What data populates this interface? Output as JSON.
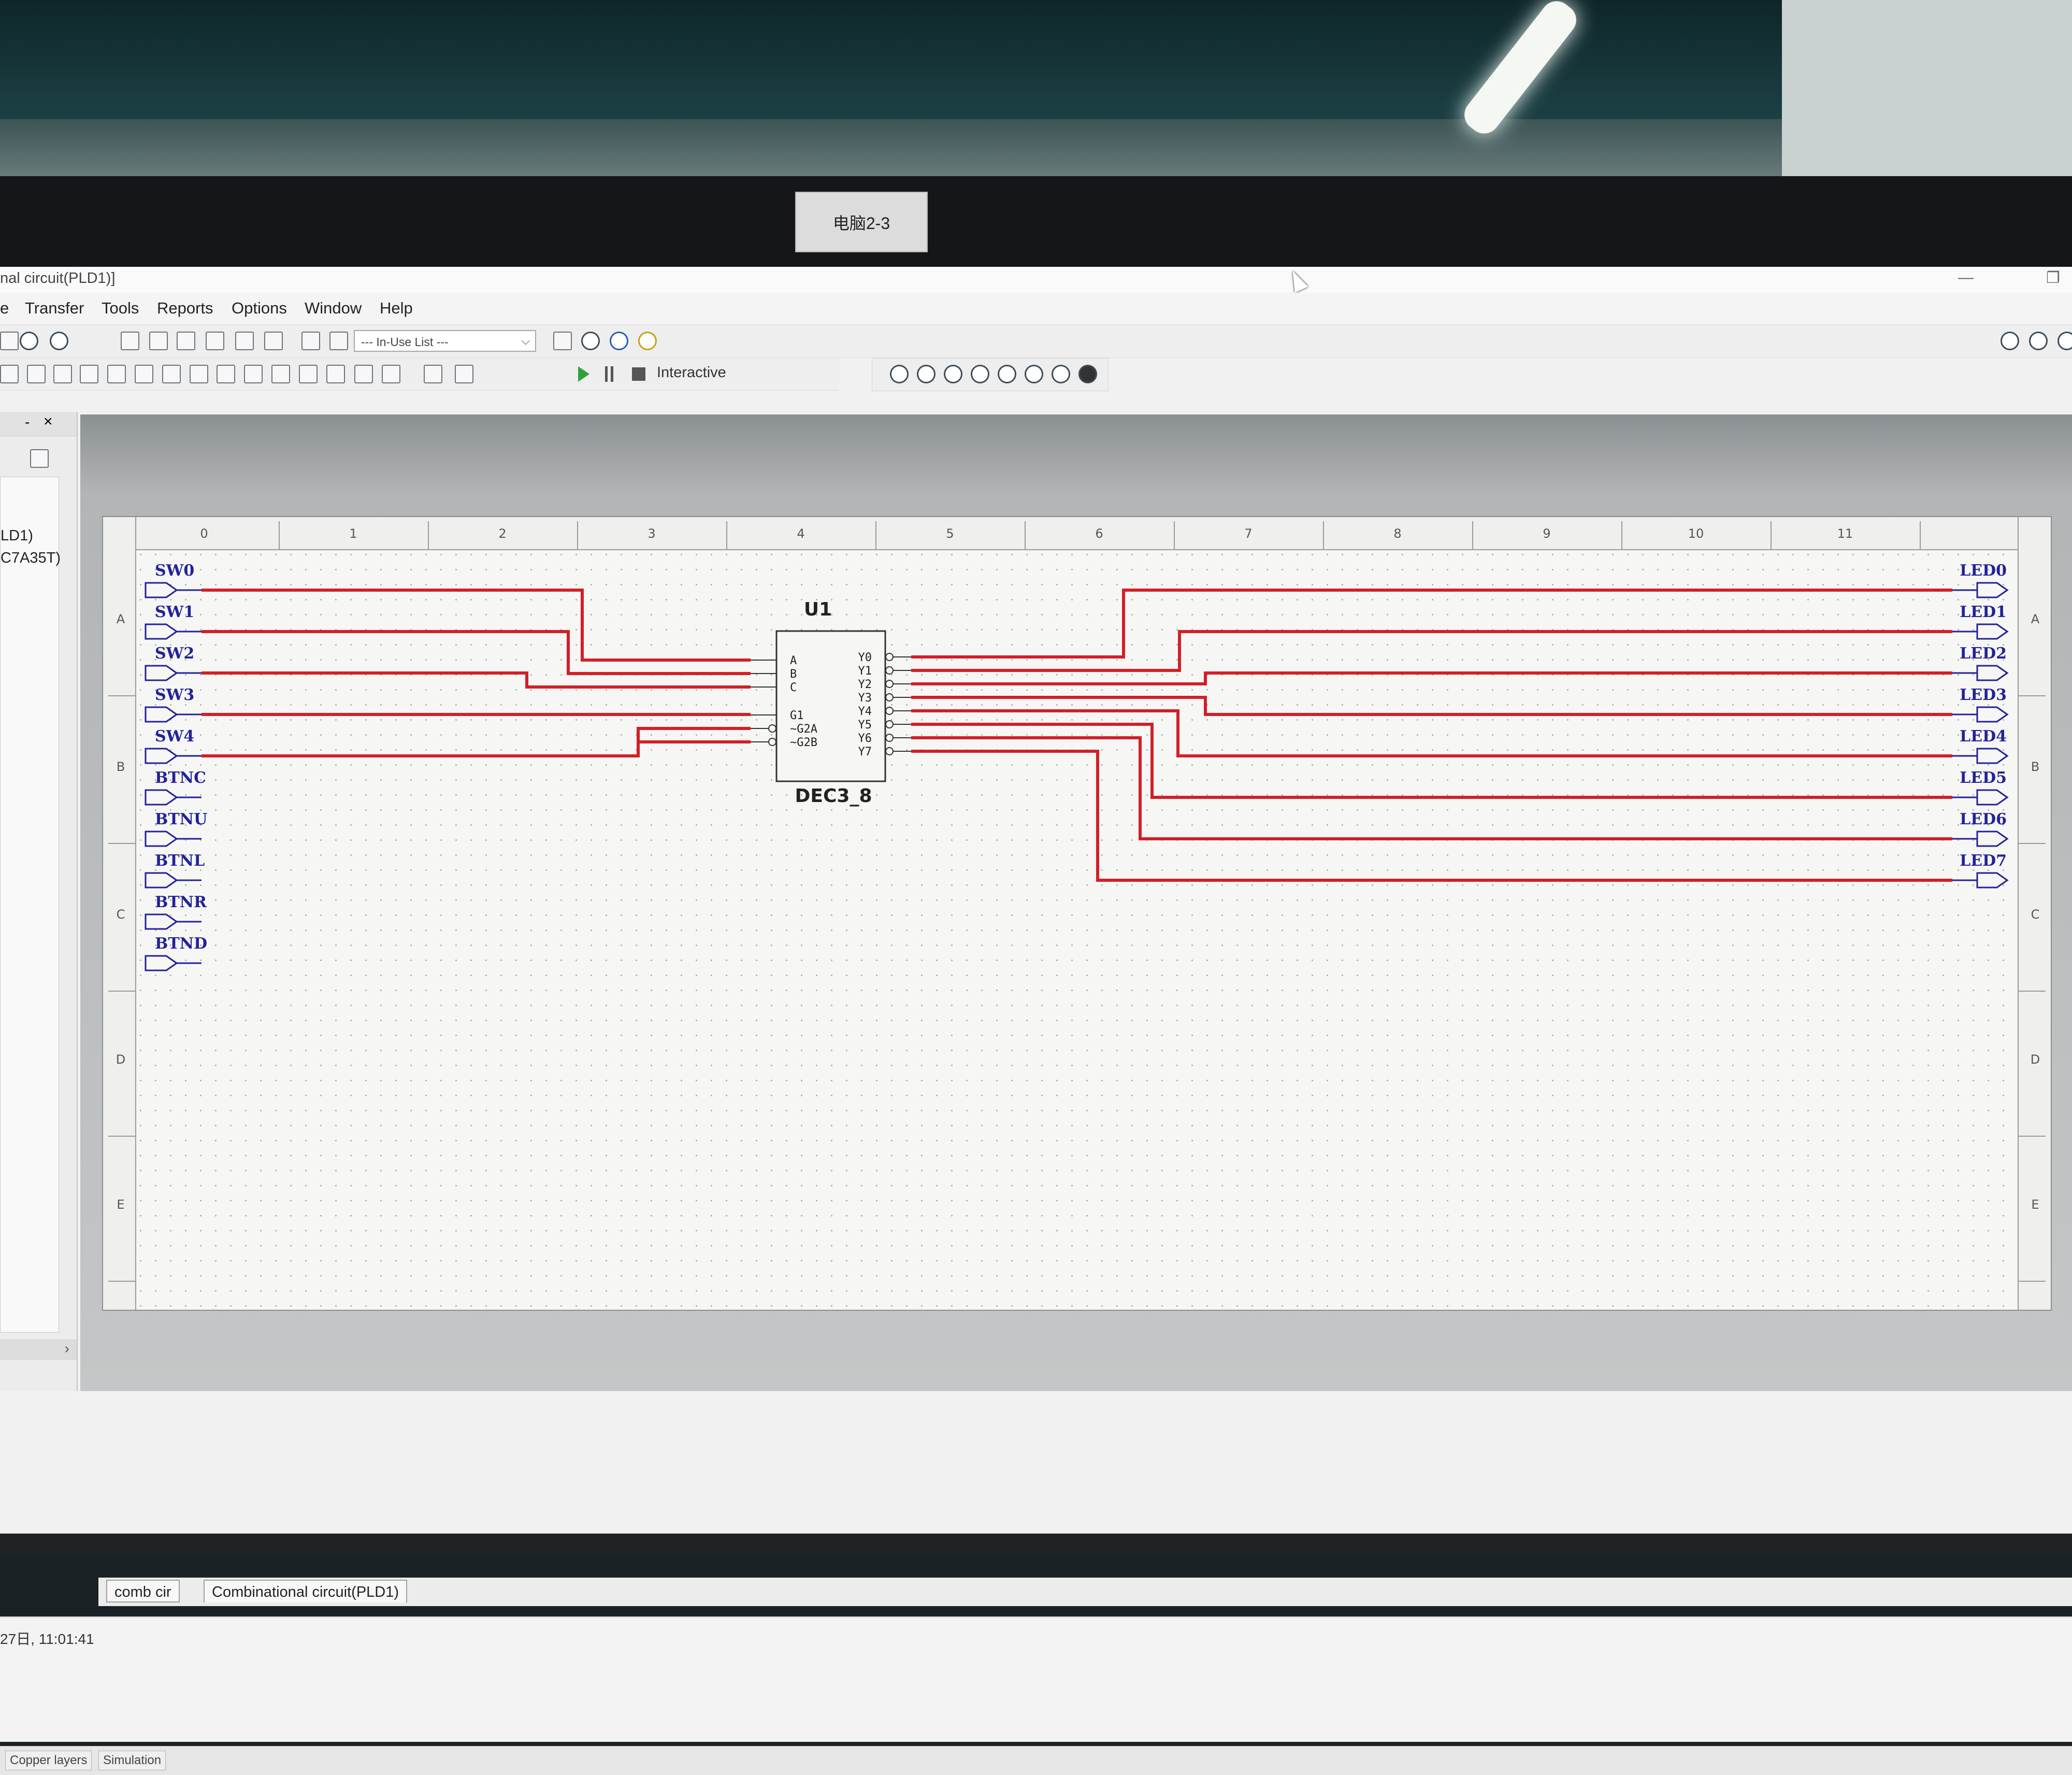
{
  "monitor_label": "电脑2-3",
  "window": {
    "title": "nal circuit(PLD1)]",
    "min_glyph": "—",
    "restore_glyph": "❐"
  },
  "menu": [
    "e",
    "Transfer",
    "Tools",
    "Reports",
    "Options",
    "Window",
    "Help"
  ],
  "toolbar": {
    "in_use_list": "--- In-Use List ---",
    "interactive_label": "Interactive"
  },
  "left_panel": {
    "min_glyph": "-",
    "close_glyph": "×",
    "items": [
      "LD1)",
      "C7A35T)"
    ],
    "scroll_glyph": "›"
  },
  "schematic": {
    "column_labels": [
      "0",
      "1",
      "2",
      "3",
      "4",
      "5",
      "6",
      "7",
      "8",
      "9",
      "10",
      "11"
    ],
    "row_labels": [
      "A",
      "B",
      "C",
      "D",
      "E"
    ],
    "inputs": [
      "SW0",
      "SW1",
      "SW2",
      "SW3",
      "SW4",
      "BTNC",
      "BTNU",
      "BTNL",
      "BTNR",
      "BTND"
    ],
    "outputs": [
      "LED0",
      "LED1",
      "LED2",
      "LED3",
      "LED4",
      "LED5",
      "LED6",
      "LED7"
    ],
    "component": {
      "ref": "U1",
      "type": "DEC3_8",
      "left_pins": [
        "A",
        "B",
        "C",
        "G1",
        "~G2A",
        "~G2B"
      ],
      "right_pins": [
        "Y0",
        "Y1",
        "Y2",
        "Y3",
        "Y4",
        "Y5",
        "Y6",
        "Y7"
      ]
    },
    "wire_color": "#d21f27",
    "port_color": "#22229a"
  },
  "tabs": [
    "comb cir",
    "Combinational circuit(PLD1)"
  ],
  "status": "27日, 11:01:41",
  "bottom_tabs": [
    "Copper layers",
    "Simulation"
  ]
}
